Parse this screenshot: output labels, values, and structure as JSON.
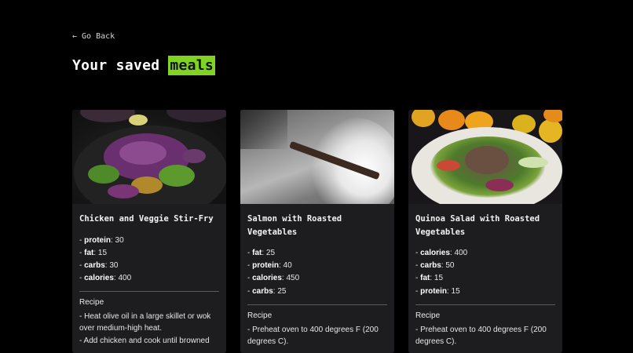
{
  "nav": {
    "back_icon": "arrow-left-icon",
    "back_label": "Go Back"
  },
  "page": {
    "title_prefix": "Your saved",
    "title_highlight": "meals",
    "highlight_color": "#7fd321"
  },
  "meals": [
    {
      "title": "Chicken and Veggie Stir-Fry",
      "image": "stir-fry-photo",
      "facts": [
        {
          "key": "protein",
          "value": ": 30"
        },
        {
          "key": "fat",
          "value": ": 15"
        },
        {
          "key": "carbs",
          "value": ": 30"
        },
        {
          "key": "calories",
          "value": ": 400"
        }
      ],
      "recipe_label": "Recipe",
      "steps": [
        "- Heat olive oil in a large skillet or wok over medium-high heat.",
        "- Add chicken and cook until browned"
      ]
    },
    {
      "title": "Salmon with Roasted Vegetables",
      "image": "salmon-photo",
      "facts": [
        {
          "key": "fat",
          "value": ": 25"
        },
        {
          "key": "protein",
          "value": ": 40"
        },
        {
          "key": "calories",
          "value": ": 450"
        },
        {
          "key": "carbs",
          "value": ": 25"
        }
      ],
      "recipe_label": "Recipe",
      "steps": [
        "- Preheat oven to 400 degrees F (200 degrees C)."
      ]
    },
    {
      "title": "Quinoa Salad with Roasted Vegetables",
      "image": "quinoa-salad-photo",
      "facts": [
        {
          "key": "calories",
          "value": ": 400"
        },
        {
          "key": "carbs",
          "value": ": 50"
        },
        {
          "key": "fat",
          "value": ": 15"
        },
        {
          "key": "protein",
          "value": ": 15"
        }
      ],
      "recipe_label": "Recipe",
      "steps": [
        "- Preheat oven to 400 degrees F (200 degrees C)."
      ]
    }
  ]
}
